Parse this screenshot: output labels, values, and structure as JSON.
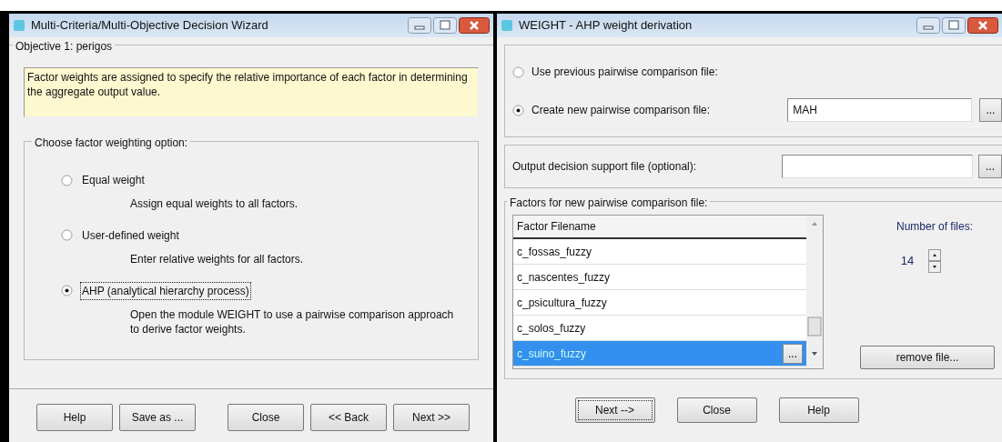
{
  "wizard_window": {
    "title": "Multi-Criteria/Multi-Objective Decision Wizard",
    "group_title": "Objective 1: perigos",
    "info_text": "Factor weights are assigned to specify the relative importance of each factor in determining the aggregate output value.",
    "options_group": {
      "title": "Choose factor weighting option:",
      "options": [
        {
          "label": "Equal weight",
          "description": "Assign equal weights to all factors.",
          "selected": false,
          "focused": false
        },
        {
          "label": "User-defined weight",
          "description": "Enter relative weights for all factors.",
          "selected": false,
          "focused": false
        },
        {
          "label": "AHP (analytical hierarchy process)",
          "description": "Open the module WEIGHT to use a pairwise comparison approach to derive factor weights.",
          "selected": true,
          "focused": true
        }
      ]
    },
    "buttons": [
      {
        "label": "Help",
        "focused": false
      },
      {
        "label": "Save as ...",
        "focused": false
      },
      {
        "label": "Close",
        "focused": false
      },
      {
        "label": "<< Back",
        "focused": false
      },
      {
        "label": "Next >>",
        "focused": false
      }
    ]
  },
  "weight_window": {
    "title": "WEIGHT - AHP weight derivation",
    "source_options": [
      {
        "label": "Use previous pairwise comparison file:",
        "selected": false
      },
      {
        "label": "Create new pairwise comparison file:",
        "selected": true,
        "value": "MAH",
        "browse": "..."
      }
    ],
    "output": {
      "label": "Output decision support file (optional):",
      "browse": "..."
    },
    "factors": {
      "title": "Factors for new pairwise comparison file:",
      "column": "Factor Filename",
      "rows": [
        {
          "name": "c_fossas_fuzzy",
          "selected": false
        },
        {
          "name": "c_nascentes_fuzzy",
          "selected": false
        },
        {
          "name": "c_psicultura_fuzzy",
          "selected": false
        },
        {
          "name": "c_solos_fuzzy",
          "selected": false
        },
        {
          "name": "c_suino_fuzzy",
          "selected": true,
          "browse": "..."
        }
      ]
    },
    "number_of_files": {
      "label": "Number of files:",
      "value": "14"
    },
    "remove_button": "remove file...",
    "buttons": [
      {
        "label": "Next -->",
        "focused": true
      },
      {
        "label": "Close",
        "focused": false
      },
      {
        "label": "Help",
        "focused": false
      }
    ]
  }
}
